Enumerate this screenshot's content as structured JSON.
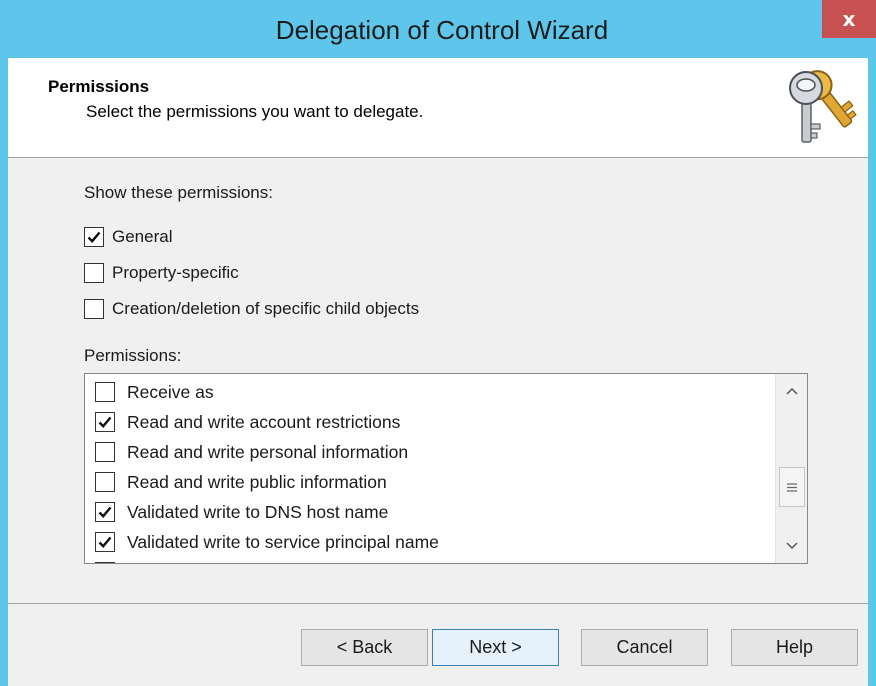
{
  "window": {
    "title": "Delegation of Control Wizard",
    "close_label": "x",
    "colors": {
      "titlebar": "#5ec6eb",
      "close": "#c75050",
      "body": "#f0f0f0"
    }
  },
  "header": {
    "title": "Permissions",
    "subtitle": "Select the permissions you want to delegate.",
    "icon": "keys-icon"
  },
  "show": {
    "label": "Show these permissions:",
    "options": [
      {
        "label": "General",
        "checked": true
      },
      {
        "label": "Property-specific",
        "checked": false
      },
      {
        "label": "Creation/deletion of specific child objects",
        "checked": false
      }
    ]
  },
  "permissions": {
    "label": "Permissions:",
    "items": [
      {
        "label": "Receive as",
        "checked": false
      },
      {
        "label": "Read and write account restrictions",
        "checked": true
      },
      {
        "label": "Read and write personal information",
        "checked": false
      },
      {
        "label": "Read and write public information",
        "checked": false
      },
      {
        "label": "Validated write to DNS host name",
        "checked": true
      },
      {
        "label": "Validated write to service principal name",
        "checked": true
      }
    ]
  },
  "buttons": {
    "back": "< Back",
    "next": "Next >",
    "cancel": "Cancel",
    "help": "Help"
  }
}
